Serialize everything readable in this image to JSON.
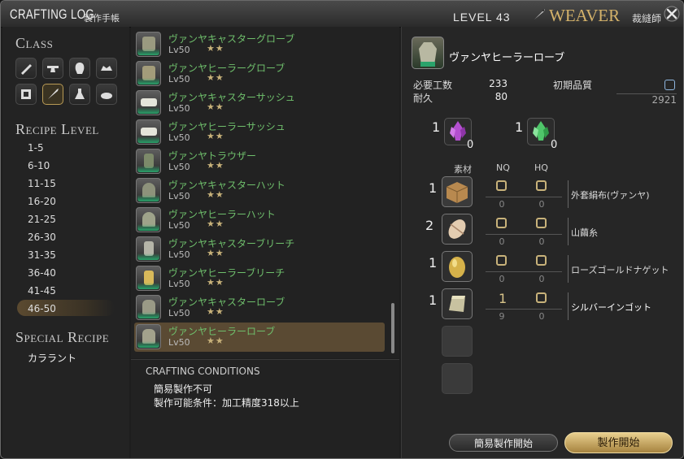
{
  "titlebar": {
    "title": "CRAFTING LOG",
    "subtitle": "製作手帳",
    "level_label": "LEVEL 43",
    "job": "WEAVER",
    "job_jp": "裁縫師"
  },
  "sidebar": {
    "class_heading": "Class",
    "class_icons": [
      "carpenter-icon",
      "blacksmith-icon",
      "armorer-icon",
      "goldsmith-icon",
      "leatherworker-icon",
      "weaver-icon",
      "alchemist-icon",
      "culinarian-icon"
    ],
    "selected_class_index": 5,
    "recipe_level_heading": "Recipe Level",
    "levels": [
      "1-5",
      "6-10",
      "11-15",
      "16-20",
      "21-25",
      "26-30",
      "31-35",
      "36-40",
      "41-45",
      "46-50"
    ],
    "selected_level": "46-50",
    "special_heading": "Special Recipe",
    "special_items": [
      "カララント"
    ]
  },
  "recipes": [
    {
      "name": "ヴァンヤキャスターグローブ",
      "level": "Lv50",
      "stars": "★★",
      "icon": "glove-icon"
    },
    {
      "name": "ヴァンヤヒーラーグローブ",
      "level": "Lv50",
      "stars": "★★",
      "icon": "glove-icon"
    },
    {
      "name": "ヴァンヤキャスターサッシュ",
      "level": "Lv50",
      "stars": "★★",
      "icon": "sash-icon"
    },
    {
      "name": "ヴァンヤヒーラーサッシュ",
      "level": "Lv50",
      "stars": "★★",
      "icon": "sash-icon"
    },
    {
      "name": "ヴァンヤトラウザー",
      "level": "Lv50",
      "stars": "★★",
      "icon": "trousers-icon"
    },
    {
      "name": "ヴァンヤキャスターハット",
      "level": "Lv50",
      "stars": "★★",
      "icon": "hat-icon"
    },
    {
      "name": "ヴァンヤヒーラーハット",
      "level": "Lv50",
      "stars": "★★",
      "icon": "hat-icon"
    },
    {
      "name": "ヴァンヤキャスターブリーチ",
      "level": "Lv50",
      "stars": "★★",
      "icon": "breeches-icon"
    },
    {
      "name": "ヴァンヤヒーラーブリーチ",
      "level": "Lv50",
      "stars": "★★",
      "icon": "breeches-icon"
    },
    {
      "name": "ヴァンヤキャスターローブ",
      "level": "Lv50",
      "stars": "★★",
      "icon": "robe-icon"
    },
    {
      "name": "ヴァンヤヒーラーローブ",
      "level": "Lv50",
      "stars": "★★",
      "icon": "robe-icon"
    }
  ],
  "selected_recipe_index": 10,
  "conditions": {
    "heading": "CRAFTING CONDITIONS",
    "lines": [
      "簡易製作不可",
      "製作可能条件：加工精度318以上"
    ]
  },
  "detail": {
    "item_name": "ヴァンヤヒーラーローブ",
    "difficulty_label": "必要工数",
    "difficulty": "233",
    "durability_label": "耐久",
    "durability": "80",
    "initial_quality_label": "初期品質",
    "initial_quality": "2921",
    "crystals": [
      {
        "required": "1",
        "owned": "0",
        "icon": "lightning-shard-icon",
        "color": "#b44fd0"
      },
      {
        "required": "1",
        "owned": "0",
        "icon": "wind-shard-icon",
        "color": "#4fc66a"
      }
    ],
    "col_material": "素材",
    "col_nq": "NQ",
    "col_hq": "HQ",
    "ingredients": [
      {
        "qty": "1",
        "name": "外套絹布(ヴァンヤ)",
        "nq_sel": "",
        "hq_sel": "",
        "nq_have": "0",
        "hq_have": "0",
        "icon": "cloth-bolt-icon"
      },
      {
        "qty": "2",
        "name": "山繭糸",
        "nq_sel": "",
        "hq_sel": "",
        "nq_have": "0",
        "hq_have": "0",
        "icon": "cocoon-thread-icon"
      },
      {
        "qty": "1",
        "name": "ローズゴールドナゲット",
        "nq_sel": "",
        "hq_sel": "",
        "nq_have": "0",
        "hq_have": "0",
        "icon": "gold-nugget-icon"
      },
      {
        "qty": "1",
        "name": "シルバーインゴット",
        "nq_sel": "1",
        "hq_sel": "",
        "nq_have": "9",
        "hq_have": "0",
        "icon": "silver-ingot-icon"
      }
    ],
    "quick_synth_label": "簡易製作開始",
    "synth_label": "製作開始"
  },
  "colors": {
    "accent_gold": "#c8b27a",
    "recipe_name": "#6fbf6c",
    "selection": "#5a4a33"
  }
}
